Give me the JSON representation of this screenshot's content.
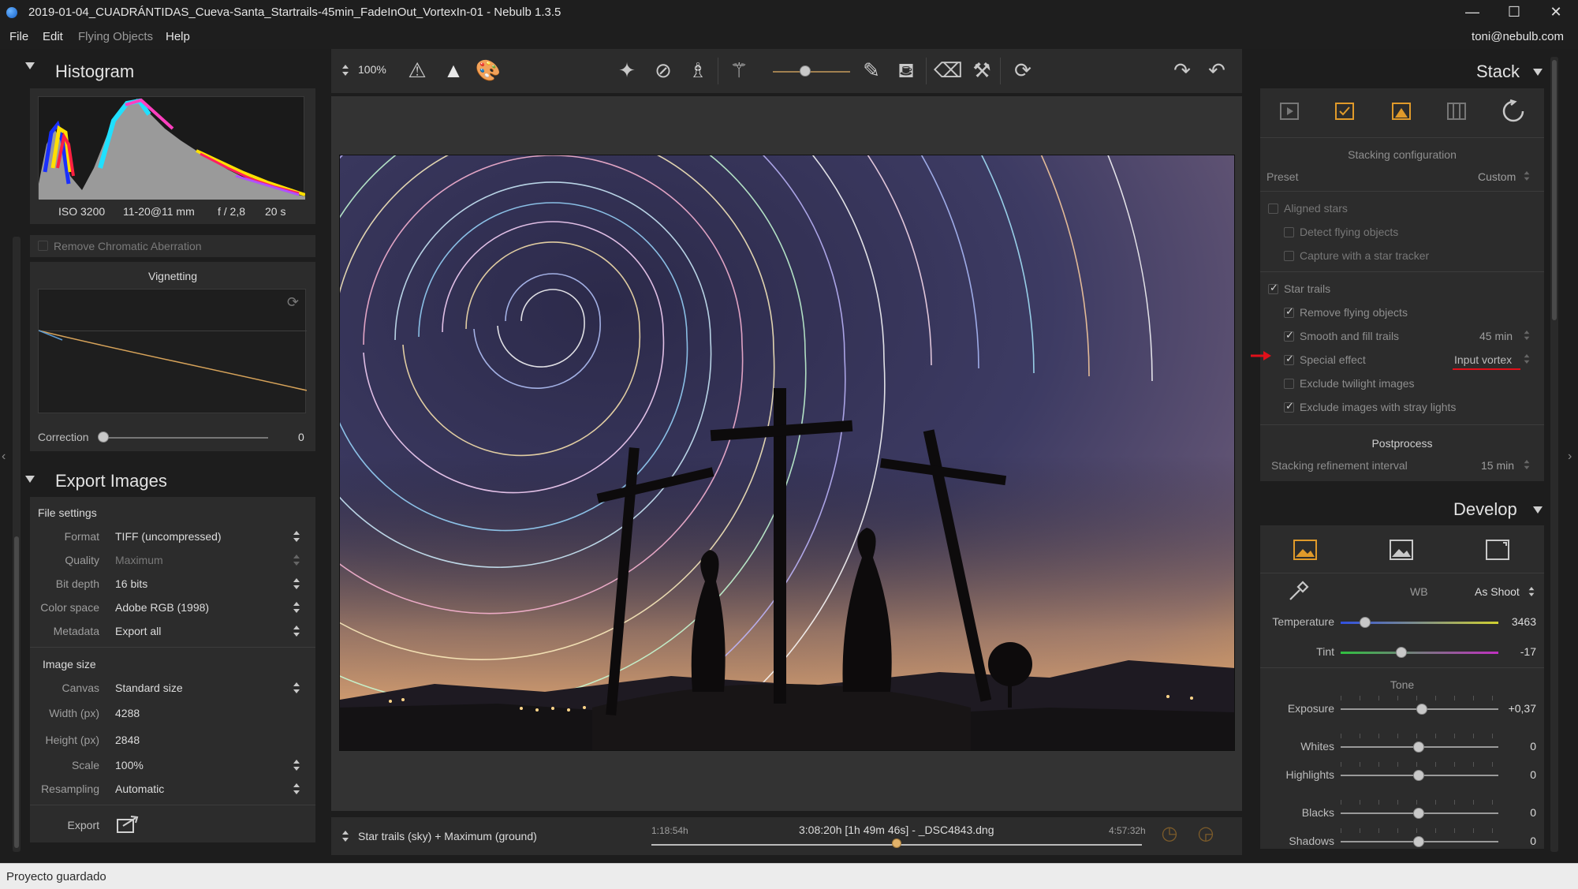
{
  "window": {
    "title": "2019-01-04_CUADRÁNTIDAS_Cueva-Santa_Startrails-45min_FadeInOut_VortexIn-01 - Nebulb 1.3.5",
    "min_glyph": "—",
    "max_glyph": "☐",
    "close_glyph": "✕"
  },
  "menu": {
    "file": "File",
    "edit": "Edit",
    "flying_objects": "Flying Objects",
    "help": "Help",
    "user": "toni@nebulb.com"
  },
  "histogram": {
    "title": "Histogram",
    "iso": "ISO 3200",
    "lens": "11-20@11 mm",
    "aperture": "f / 2,8",
    "shutter": "20 s"
  },
  "lens_corrections": {
    "remove_ca": "Remove Chromatic Aberration",
    "vignetting_title": "Vignetting",
    "correction_label": "Correction",
    "correction_value": "0"
  },
  "export": {
    "title": "Export Images",
    "file_settings": "File settings",
    "format_label": "Format",
    "format_value": "TIFF (uncompressed)",
    "quality_label": "Quality",
    "quality_value": "Maximum",
    "bitdepth_label": "Bit depth",
    "bitdepth_value": "16 bits",
    "colorspace_label": "Color space",
    "colorspace_value": "Adobe RGB (1998)",
    "metadata_label": "Metadata",
    "metadata_value": "Export all",
    "image_size": "Image size",
    "canvas_label": "Canvas",
    "canvas_value": "Standard size",
    "width_label": "Width (px)",
    "width_value": "4288",
    "height_label": "Height (px)",
    "height_value": "2848",
    "scale_label": "Scale",
    "scale_value": "100%",
    "resampling_label": "Resampling",
    "resampling_value": "Automatic",
    "export_label": "Export"
  },
  "toolbar": {
    "zoom": "100%"
  },
  "timeline": {
    "mode": "Star trails (sky) + Maximum (ground)",
    "start": "1:18:54h",
    "current": "3:08:20h [1h 49m 46s] - _DSC4843.dng",
    "end": "4:57:32h",
    "position": 0.5
  },
  "stack": {
    "title": "Stack",
    "config_title": "Stacking configuration",
    "preset_label": "Preset",
    "preset_value": "Custom",
    "aligned_stars": "Aligned stars",
    "detect_flying": "Detect flying objects",
    "capture_tracker": "Capture with a star tracker",
    "star_trails": "Star trails",
    "remove_flying": "Remove flying objects",
    "smooth_fill": "Smooth and fill trails",
    "smooth_value": "45 min",
    "special_effect": "Special effect",
    "special_value": "Input vortex",
    "exclude_twilight": "Exclude twilight images",
    "exclude_stray": "Exclude images with stray lights",
    "postprocess": "Postprocess",
    "refine_label": "Stacking refinement interval",
    "refine_value": "15 min"
  },
  "develop": {
    "title": "Develop",
    "wb_label": "WB",
    "wb_value": "As Shoot",
    "temperature_label": "Temperature",
    "temperature_value": "3463",
    "tint_label": "Tint",
    "tint_value": "-17",
    "tone_title": "Tone",
    "exposure_label": "Exposure",
    "exposure_value": "+0,37",
    "whites_label": "Whites",
    "whites_value": "0",
    "highlights_label": "Highlights",
    "highlights_value": "0",
    "blacks_label": "Blacks",
    "blacks_value": "0",
    "shadows_label": "Shadows",
    "shadows_value": "0"
  },
  "status": {
    "text": "Proyecto guardado"
  },
  "colors": {
    "accent_orange": "#e09a2a",
    "annotation_red": "#e0101a"
  }
}
